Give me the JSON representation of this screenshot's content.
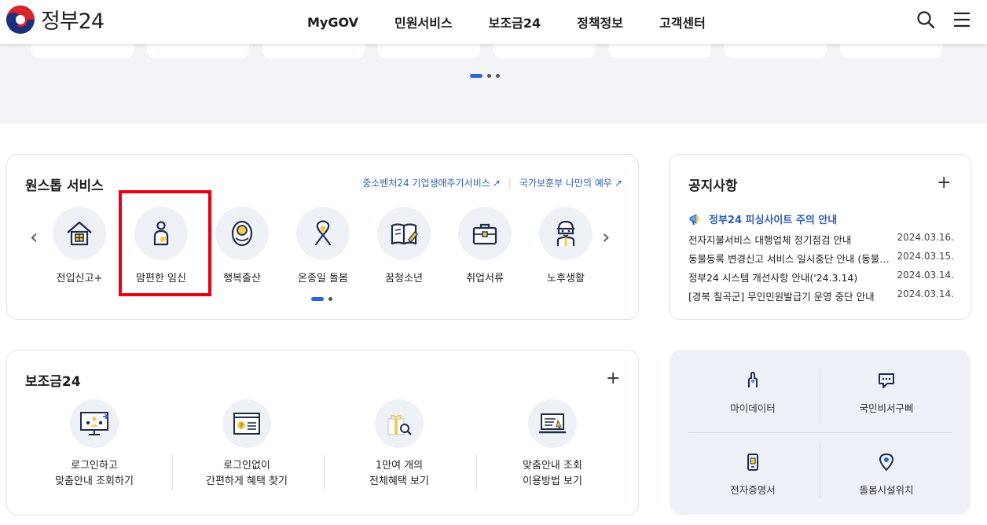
{
  "header": {
    "logo_text": "정부24",
    "nav": [
      "MyGOV",
      "민원서비스",
      "보조금24",
      "정책정보",
      "고객센터"
    ]
  },
  "one_stop": {
    "title": "원스톱 서비스",
    "link1": "중소벤처24 기업생애주기서비스",
    "link2": "국가보훈부 나만의 예우",
    "items": [
      "전입신고+",
      "맘편한 임신",
      "행복출산",
      "온종일 돌봄",
      "꿈청소년",
      "취업서류",
      "노후생활"
    ]
  },
  "notice": {
    "title": "공지사항",
    "highlight": "정부24 피싱사이트 주의 안내",
    "rows": [
      {
        "title": "전자지불서비스 대행업체 정기점검 안내",
        "date": "2024.03.16."
      },
      {
        "title": "동물등록 변경신고 서비스 일시중단 안내 (동물등록",
        "date": "2024.03.15."
      },
      {
        "title": "정부24 시스템 개선사항 안내('24.3.14)",
        "date": "2024.03.14."
      },
      {
        "title": "[경북 칠곡군] 무인민원발급기 운영 중단 안내",
        "date": "2024.03.14."
      }
    ]
  },
  "subsidy": {
    "title": "보조금24",
    "items": [
      {
        "line1": "로그인하고",
        "line2": "맞춤안내 조회하기"
      },
      {
        "line1": "로그인없이",
        "line2": "간편하게 혜택 찾기"
      },
      {
        "line1": "1만여 개의",
        "line2": "전체혜택 보기"
      },
      {
        "line1": "맞춤안내 조회",
        "line2": "이용방법 보기"
      }
    ]
  },
  "quick": [
    "마이데이터",
    "국민비서구삐",
    "전자증명서",
    "돌봄시설위치"
  ],
  "colors": {
    "accent": "#2d64d8",
    "link": "#2b5fb4",
    "highlight_box": "#e60012",
    "banner_bg": "#f2f4f8"
  }
}
